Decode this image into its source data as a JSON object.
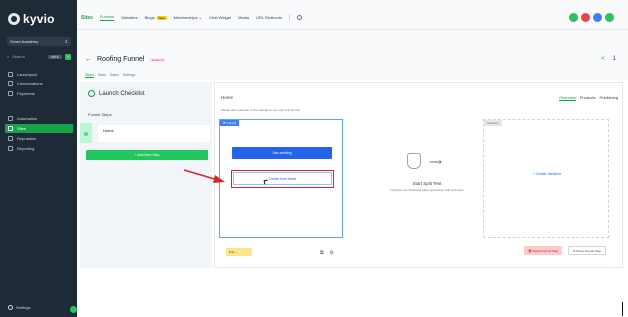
{
  "sidebar": {
    "logo_text": "kyvio",
    "account_name": "Smart Academy",
    "search_placeholder": "Search",
    "search_shortcut": "ctrl K",
    "nav_items": [
      {
        "label": "Launchpad",
        "icon": "rocket-icon"
      },
      {
        "label": "Conversations",
        "icon": "chat-icon"
      },
      {
        "label": "Payments",
        "icon": "payments-icon"
      },
      {
        "label": "Automation",
        "icon": "automation-icon"
      },
      {
        "label": "Sites",
        "icon": "globe-icon",
        "active": true
      },
      {
        "label": "Reputation",
        "icon": "star-icon"
      },
      {
        "label": "Reporting",
        "icon": "chart-icon"
      }
    ],
    "settings_label": "Settings"
  },
  "topbar": {
    "section": "Sites",
    "tabs": [
      "Funnels",
      "Websites",
      "Blogs",
      "Memberships",
      "Chat Widget",
      "Media",
      "URL Redirects"
    ],
    "new_badge": "New",
    "memberships_chevron": "⌄",
    "icon_colors": [
      "#22c55e",
      "#ef4444",
      "#3b82f6",
      "#22c55e"
    ]
  },
  "funnel_header": {
    "back_icon": "←",
    "title": "Roofing Funnel",
    "version_badge": "Version 2",
    "subtabs": [
      "Steps",
      "Stats",
      "Sales",
      "Settings"
    ],
    "share_icon": "<",
    "count": "1"
  },
  "steps_panel": {
    "launch_checklist": "Launch Checklist",
    "funnel_steps_label": "Funnel Steps",
    "steps": [
      {
        "label": "Home"
      }
    ],
    "add_step_button": "+ Add New Step"
  },
  "main_panel": {
    "title": "Home",
    "right_tabs": [
      "Overview",
      "Products",
      "Publishing"
    ],
    "domain_note": "Please add a domain in the settings to see your Funnel live!",
    "control_tag": "Control",
    "use_existing": "Use existing",
    "create_from_blank": "Create from blank",
    "edit_chip": "Edit",
    "split_test_title": "Start Split Test",
    "split_test_sub": "Optimize your lead and sales generation with split tests",
    "variation_tag": "Variation",
    "create_variation": "+ Create Variation",
    "delete_button": "Delete Funnel Step",
    "clone_button": "Clone Funnel Step"
  },
  "colors": {
    "accent_green": "#16a34a",
    "sidebar_bg": "#1f2a37",
    "highlight_red": "#dc2626",
    "primary_blue": "#2563eb"
  }
}
